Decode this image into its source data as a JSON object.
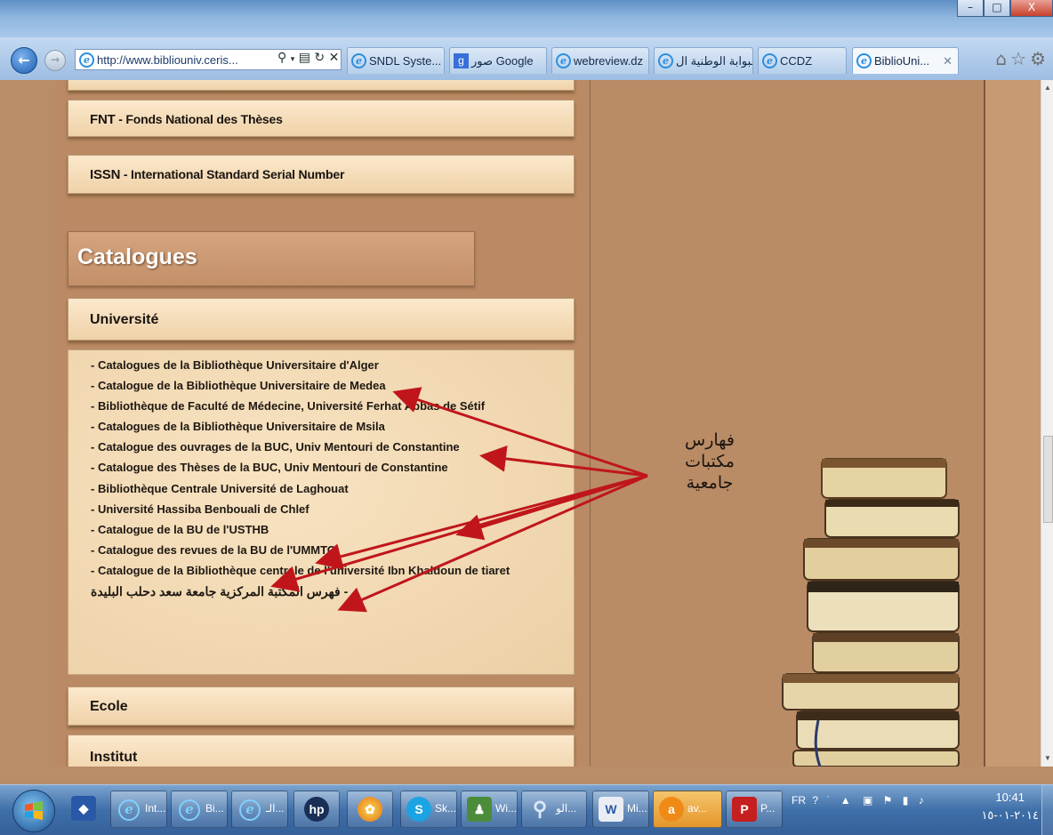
{
  "browser": {
    "address_url": "http://www.bibliouniv.ceris...",
    "tabs": [
      {
        "label": "SNDL Syste..."
      },
      {
        "label": "صور Google"
      },
      {
        "label": "webreview.dz"
      },
      {
        "label": "البوابة الوطنية ال..."
      },
      {
        "label": "CCDZ"
      },
      {
        "label": "BiblioUni...",
        "active": true
      }
    ],
    "right_icons": [
      "home-icon",
      "favorites-star-icon",
      "gear-icon"
    ]
  },
  "page": {
    "menu_items": [
      {
        "abbr": "FNT",
        "label": " - Fonds National des Thèses"
      },
      {
        "abbr": "ISSN",
        "label": " - International Standard Serial Number"
      }
    ],
    "catalogues_heading": "Catalogues",
    "universite_heading": "Université",
    "university_links": [
      "- Catalogues de la Bibliothèque Universitaire d'Alger",
      "- Catalogue de la Bibliothèque Universitaire de Medea",
      "- Bibliothèque de Faculté de Médecine, Université Ferhat Abbas de Sétif",
      "- Catalogues de la Bibliothèque Universitaire de Msila",
      "- Catalogue des ouvrages de la BUC, Univ Mentouri de Constantine",
      "- Catalogue des Thèses de la BUC, Univ Mentouri de Constantine",
      "- Bibliothèque Centrale Université de Laghouat",
      "- Université Hassiba Benbouali de Chlef",
      "- Catalogue de la BU de l'USTHB",
      "- Catalogue des revues de la BU de l'UMMTO",
      "- Catalogue de la Bibliothèque centrale de l'université Ibn Khaldoun de tiaret",
      "- فهرس المكتبة المركزية جامعة سعد دحلب البليدة"
    ],
    "ecole_heading": "Ecole",
    "institut_heading": "Institut",
    "annotation": [
      "فهارس",
      "مكتبات",
      "جامعية"
    ],
    "annotation_arrow_color": "#c0161b"
  },
  "taskbar": {
    "items": [
      {
        "label": "Int...",
        "icon": "ie-icon"
      },
      {
        "label": "Bi...",
        "icon": "ie-icon"
      },
      {
        "label": "الـ...",
        "icon": "ie-icon"
      },
      {
        "label": "",
        "icon": "hp-icon"
      },
      {
        "label": "",
        "icon": "app-icon"
      },
      {
        "label": "Sk...",
        "icon": "skype-icon"
      },
      {
        "label": "Wi...",
        "icon": "users-icon"
      },
      {
        "label": "الو...",
        "icon": "search-icon"
      },
      {
        "label": "Mi...",
        "icon": "word-icon"
      },
      {
        "label": "av...",
        "icon": "avast-icon"
      },
      {
        "label": "P...",
        "icon": "pdf-icon"
      }
    ],
    "language": "FR",
    "clock_time": "10:41",
    "clock_date": "٢٠١٤-٠١-١٥"
  }
}
